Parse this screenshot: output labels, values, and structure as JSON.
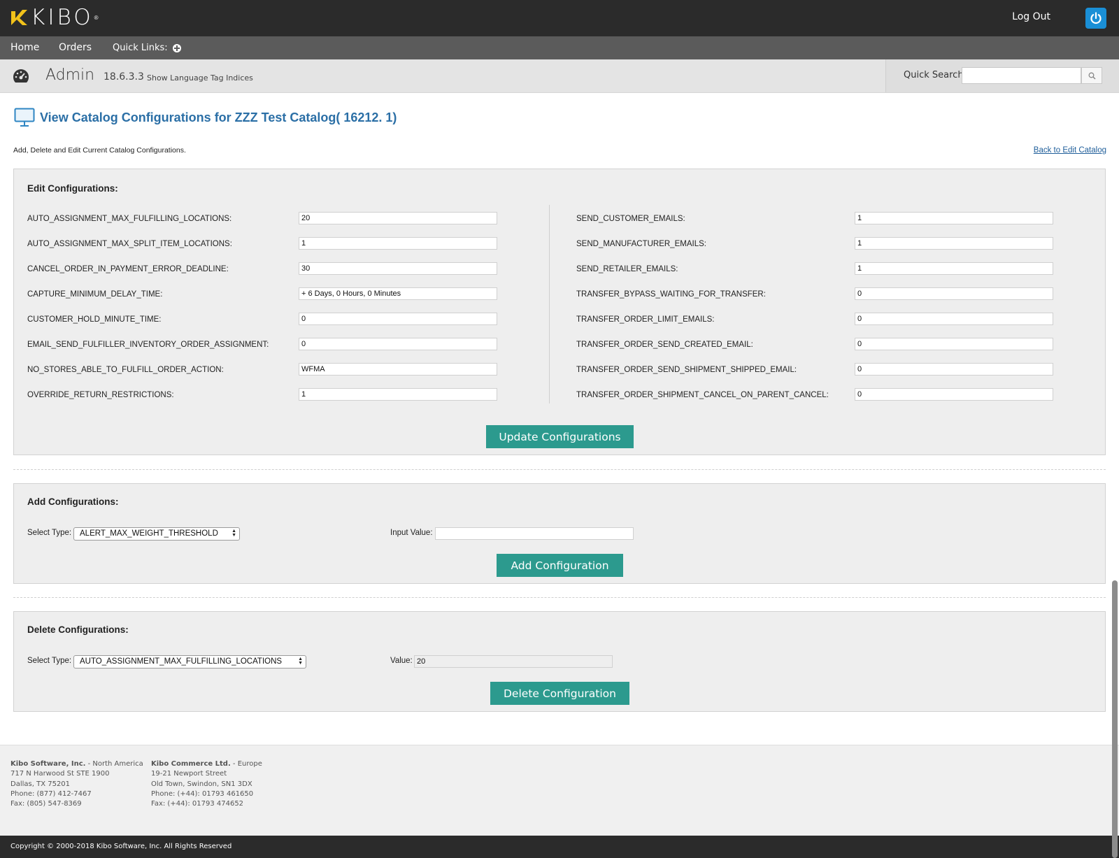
{
  "header": {
    "brand": "KIBO",
    "logout_label": "Log Out",
    "icons": {
      "power": "power-icon",
      "logo": "kibo-logo-icon"
    },
    "colors": {
      "topbar": "#2b2b2b",
      "power_button": "#1a8fd6"
    }
  },
  "nav": {
    "items": [
      {
        "label": "Home"
      },
      {
        "label": "Orders"
      }
    ],
    "quick_links_label": "Quick Links:",
    "quick_links_icon": "plus-circle-icon"
  },
  "admin": {
    "title": "Admin",
    "version": "18.6.3.3",
    "language_tag_link": "Show Language Tag Indices",
    "icon": "dashboard-gauge-icon",
    "quick_search": {
      "label": "Quick Search",
      "value": "",
      "icon": "search-icon"
    }
  },
  "page": {
    "title": "View Catalog Configurations for ZZZ Test Catalog( 16212. 1)",
    "description": "Add, Delete and Edit Current Catalog Configurations.",
    "back_link": "Back to Edit Catalog",
    "icon": "monitor-icon",
    "colors": {
      "title": "#2b6fa6",
      "button": "#2c9a8e"
    }
  },
  "edit": {
    "title": "Edit Configurations:",
    "left": [
      {
        "label": "AUTO_ASSIGNMENT_MAX_FULFILLING_LOCATIONS:",
        "value": "20"
      },
      {
        "label": "AUTO_ASSIGNMENT_MAX_SPLIT_ITEM_LOCATIONS:",
        "value": "1"
      },
      {
        "label": "CANCEL_ORDER_IN_PAYMENT_ERROR_DEADLINE:",
        "value": "30"
      },
      {
        "label": "CAPTURE_MINIMUM_DELAY_TIME:",
        "value": "+ 6 Days, 0 Hours, 0 Minutes"
      },
      {
        "label": "CUSTOMER_HOLD_MINUTE_TIME:",
        "value": "0"
      },
      {
        "label": "EMAIL_SEND_FULFILLER_INVENTORY_ORDER_ASSIGNMENT:",
        "value": "0"
      },
      {
        "label": "NO_STORES_ABLE_TO_FULFILL_ORDER_ACTION:",
        "value": "WFMA"
      },
      {
        "label": "OVERRIDE_RETURN_RESTRICTIONS:",
        "value": "1"
      }
    ],
    "right": [
      {
        "label": "SEND_CUSTOMER_EMAILS:",
        "value": "1"
      },
      {
        "label": "SEND_MANUFACTURER_EMAILS:",
        "value": "1"
      },
      {
        "label": "SEND_RETAILER_EMAILS:",
        "value": "1"
      },
      {
        "label": "TRANSFER_BYPASS_WAITING_FOR_TRANSFER:",
        "value": "0"
      },
      {
        "label": "TRANSFER_ORDER_LIMIT_EMAILS:",
        "value": "0"
      },
      {
        "label": "TRANSFER_ORDER_SEND_CREATED_EMAIL:",
        "value": "0"
      },
      {
        "label": "TRANSFER_ORDER_SEND_SHIPMENT_SHIPPED_EMAIL:",
        "value": "0"
      },
      {
        "label": "TRANSFER_ORDER_SHIPMENT_CANCEL_ON_PARENT_CANCEL:",
        "value": "0"
      }
    ],
    "button": "Update Configurations"
  },
  "add": {
    "title": "Add Configurations:",
    "select_label": "Select Type:",
    "select_value": "ALERT_MAX_WEIGHT_THRESHOLD",
    "input_label": "Input Value:",
    "input_value": "",
    "button": "Add Configuration"
  },
  "delete": {
    "title": "Delete Configurations:",
    "select_label": "Select Type:",
    "select_value": "AUTO_ASSIGNMENT_MAX_FULFILLING_LOCATIONS",
    "value_label": "Value:",
    "value": "20",
    "button": "Delete Configuration"
  },
  "footer": {
    "na": {
      "company": "Kibo Software, Inc.",
      "region": " - North America",
      "lines": [
        "717 N Harwood St STE 1900",
        "Dallas, TX 75201",
        "Phone: (877) 412-7467",
        "Fax: (805) 547-8369"
      ]
    },
    "eu": {
      "company": "Kibo Commerce Ltd.",
      "region": " - Europe",
      "lines": [
        "19-21 Newport Street",
        "Old Town, Swindon, SN1 3DX",
        "Phone: (+44): 01793 461650",
        "Fax: (+44): 01793 474652"
      ]
    },
    "copyright": "Copyright © 2000-2018 Kibo Software, Inc. All Rights Reserved"
  }
}
